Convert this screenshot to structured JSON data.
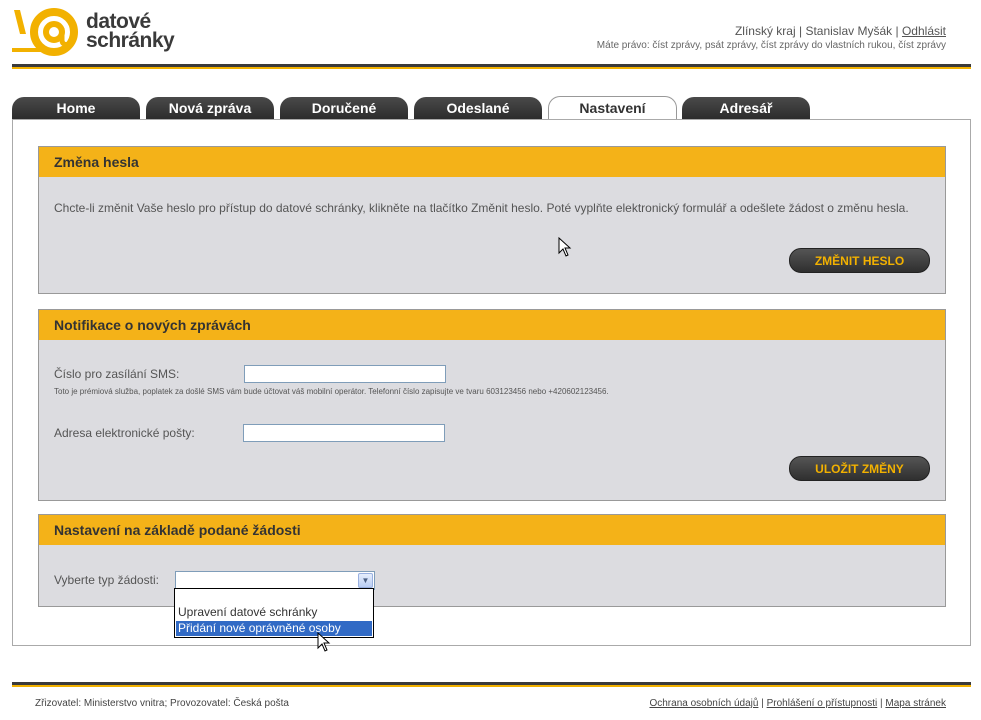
{
  "header": {
    "logo_line1": "datové",
    "logo_line2": "schránky",
    "region": "Zlínský kraj",
    "separator": "|",
    "user": "Stanislav Myšák",
    "logout": "Odhlásit",
    "rights": "Máte právo: číst zprávy, psát zprávy, číst zprávy do vlastních rukou, číst zprávy"
  },
  "tabs": [
    {
      "label": "Home"
    },
    {
      "label": "Nová zpráva"
    },
    {
      "label": "Doručené"
    },
    {
      "label": "Odeslané"
    },
    {
      "label": "Nastavení"
    },
    {
      "label": "Adresář"
    }
  ],
  "password_panel": {
    "title": "Změna hesla",
    "description": "Chcte-li změnit Vaše heslo pro přístup do datové schránky, klikněte na tlačítko Změnit heslo. Poté vyplňte elektronický formulář a odešlete žádost o změnu hesla.",
    "button": "ZMĚNIT HESLO"
  },
  "notification_panel": {
    "title": "Notifikace o nových zprávách",
    "sms_label": "Číslo pro zasílání SMS:",
    "sms_value": "",
    "sms_note": "Toto je prémiová služba, poplatek za došlé SMS vám bude účtovat váš mobilní operátor. Telefonní číslo zapisujte ve tvaru 603123456 nebo +420602123456.",
    "email_label": "Adresa elektronické pošty:",
    "email_value": "",
    "button": "ULOŽIT ZMĚNY"
  },
  "request_panel": {
    "title": "Nastavení na základě podané žádosti",
    "select_label": "Vyberte typ žádosti:",
    "select_value": "",
    "options": [
      {
        "label": "Upravení datové schránky",
        "selected": false
      },
      {
        "label": "Přidání nové oprávněné osoby",
        "selected": true
      }
    ]
  },
  "footer": {
    "left": "Zřizovatel: Ministerstvo vnitra; Provozovatel: Česká pošta",
    "links": [
      "Ochrana osobních údajů",
      "Prohlášení o přístupnosti",
      "Mapa stránek"
    ],
    "separator": "|"
  },
  "colors": {
    "accent": "#f4b218",
    "dark": "#333333",
    "panel_bg": "#dcdce0",
    "selection": "#316ac5"
  }
}
